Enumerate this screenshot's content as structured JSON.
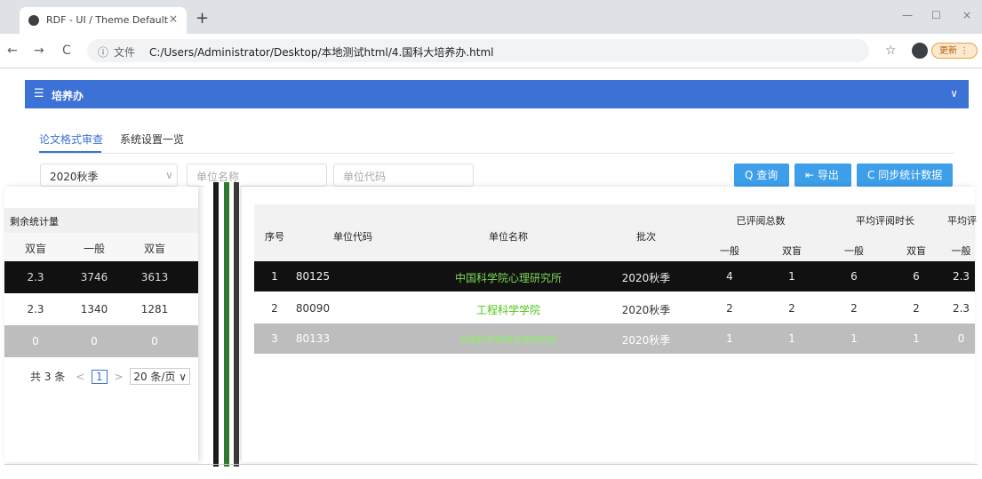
{
  "browser": {
    "tab_title": "RDF - UI / Theme Default",
    "tab_close": "×",
    "new_tab": "+",
    "win_min": "—",
    "win_max": "☐",
    "win_close": "×",
    "back": "←",
    "forward": "→",
    "reload": "C",
    "addr_info": "ⓘ",
    "addr_label": "文件",
    "url": "C:/Users/Administrator/Desktop/本地测试html/4.国科大培养办.html",
    "star": "☆",
    "update_label": "更新 ⋮"
  },
  "header": {
    "menu_icon": "☰",
    "title": "培养办",
    "chevron": "∨"
  },
  "tabs": [
    {
      "label": "论文格式审查"
    },
    {
      "label": "系统设置一览"
    }
  ],
  "filters": {
    "term": "2020秋季",
    "term_arrow": "∨",
    "unit_name_placeholder": "单位名称",
    "unit_code_placeholder": "单位代码"
  },
  "buttons": {
    "query": "Q 查询",
    "export": "⇤ 导出",
    "sync": "C 同步统计数据"
  },
  "left_table": {
    "group_header": "剩余统计量",
    "columns": [
      "双盲",
      "一般",
      "双盲"
    ],
    "rows": [
      [
        "2.3",
        "3746",
        "3613"
      ],
      [
        "2.3",
        "1340",
        "1281"
      ],
      [
        "0",
        "0",
        "0"
      ]
    ]
  },
  "pager": {
    "total": "共 3 条",
    "prev": "<",
    "current": "1",
    "next": ">",
    "page_size": "20 条/页 ∨"
  },
  "main_table": {
    "headers": {
      "index": "序号",
      "code": "单位代码",
      "name": "单位名称",
      "batch": "批次"
    },
    "groups": [
      "已评阅总数",
      "平均评阅时长",
      "平均评"
    ],
    "subcols": [
      "一般",
      "双盲",
      "一般",
      "双盲",
      "一般"
    ],
    "rows": [
      {
        "idx": "1",
        "code": "80125",
        "name": "中国科学院心理研究所",
        "batch": "2020秋季",
        "v": [
          "4",
          "1",
          "6",
          "6",
          "2.3"
        ]
      },
      {
        "idx": "2",
        "code": "80090",
        "name": "工程科学学院",
        "batch": "2020秋季",
        "v": [
          "2",
          "2",
          "2",
          "2",
          "2.3"
        ]
      },
      {
        "idx": "3",
        "code": "80133",
        "name": "中国科学院微生物研究所",
        "batch": "2020秋季",
        "v": [
          "1",
          "1",
          "1",
          "1",
          "0"
        ]
      }
    ]
  },
  "colors": {
    "primary": "#3c72d6",
    "button": "#3d9eea",
    "link_green": "#52c41a"
  }
}
